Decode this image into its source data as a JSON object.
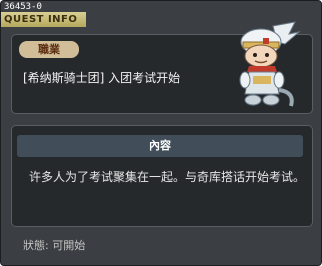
{
  "quest_id": "36453-0",
  "window_title": "QUEST INFO",
  "quest": {
    "category": "職業",
    "name": "[希纳斯骑士团] 入团考试开始"
  },
  "npc_icon": "npc-portrait-icon",
  "content": {
    "header": "內容",
    "text": "许多人为了考试聚集在一起。与奇库搭话开始考试。"
  },
  "status": "狀態: 可開始",
  "colors": {
    "window_bg": "#3b3f43",
    "panel_bg": "#26292c",
    "title_tab": "#c8bc72",
    "category_badge": "#d1bd98",
    "content_header": "#414e5a"
  }
}
